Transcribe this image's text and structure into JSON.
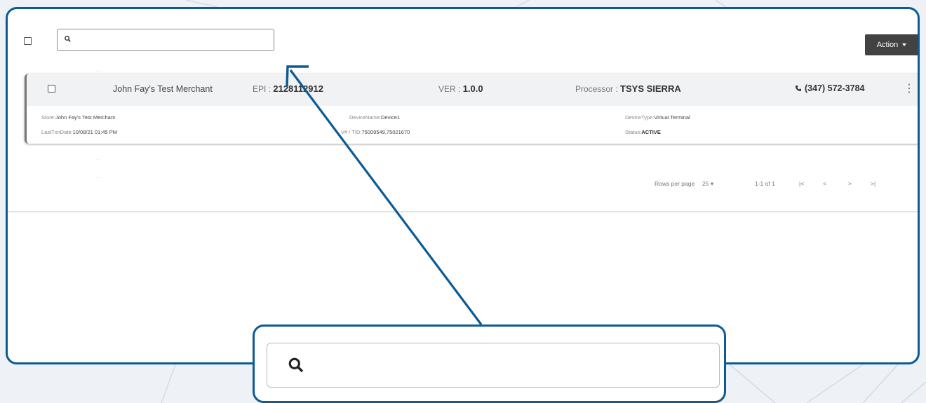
{
  "toolbar": {
    "search_placeholder": "",
    "action_label": "Action"
  },
  "device_card": {
    "merchant_name": "John Fay's Test Merchant",
    "epi_label": "EPI :",
    "epi_value": "2128112912",
    "ver_label": "VER :",
    "ver_value": "1.0.0",
    "processor_label": "Processor :",
    "processor_value": "TSYS SIERRA",
    "phone": "(347) 572-3784",
    "store_label": "Store:",
    "store_value": "John Fay's Test Merchant",
    "device_name_label": "DeviceName:",
    "device_name_value": "Device1",
    "device_type_label": "DeviceType:",
    "device_type_value": "Virtual Terminal",
    "last_txn_label": "LastTxnDate:",
    "last_txn_value": "10/08/21 01:45 PM",
    "vid_tid_label": "V# / TID:",
    "vid_tid_value": "75009549,75021670",
    "status_label": "Status:",
    "status_value": "ACTIVE"
  },
  "pagination": {
    "rows_per_page_label": "Rows per page",
    "rows_per_page_value": "25",
    "range_text": "1-1 of 1",
    "first_glyph": "|<",
    "prev_glyph": "<",
    "next_glyph": ">",
    "last_glyph": ">|"
  },
  "callout": {
    "search_placeholder": ""
  },
  "colors": {
    "frame_border": "#0d5a94",
    "arrow": "#0d5a94",
    "action_button_bg": "#424242",
    "card_header_bg": "#f1f2f4"
  }
}
